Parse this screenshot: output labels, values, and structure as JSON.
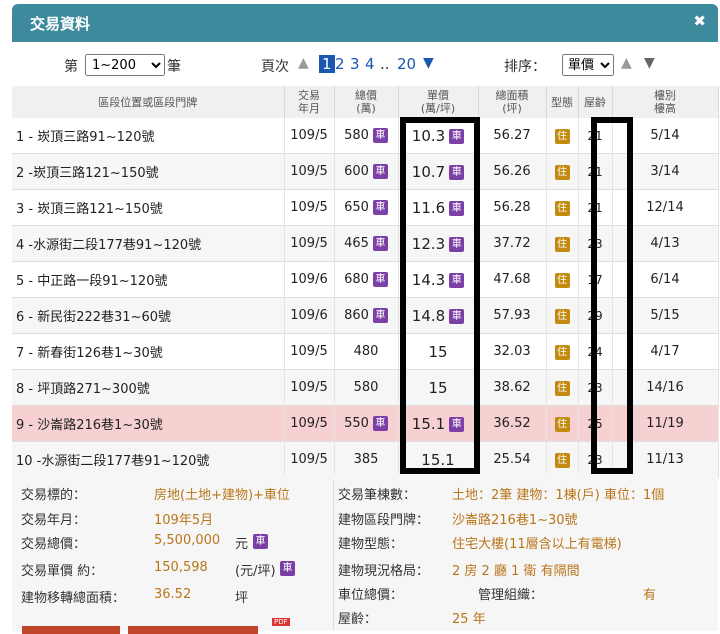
{
  "window": {
    "title": "交易資料",
    "close_glyph": "✖"
  },
  "controls": {
    "per_page_prefix": "第",
    "per_page_value": "1~200",
    "per_page_suffix": "筆",
    "page_label": "頁次",
    "pages": [
      "1",
      "2",
      "3",
      "4",
      "..",
      "20"
    ],
    "sort_label": "排序：",
    "sort_value": "單價"
  },
  "table": {
    "headers": [
      "區段位置或區段門牌",
      "交易\n年月",
      "總價\n(萬)",
      "單價\n(萬/坪)",
      "總面積\n(坪)",
      "型態",
      "屋齡",
      "樓別\n樓高"
    ],
    "car_glyph": "車",
    "residence_glyph": "住",
    "rows": [
      {
        "loc": "1 - 崁頂三路91~120號",
        "date": "109/5",
        "total": "580",
        "total_car": true,
        "unit": "10.3",
        "unit_car": true,
        "area": "56.27",
        "age": "21",
        "floor": "5/14"
      },
      {
        "loc": "2 -崁頂三路121~150號",
        "date": "109/5",
        "total": "600",
        "total_car": true,
        "unit": "10.7",
        "unit_car": true,
        "area": "56.26",
        "age": "21",
        "floor": "3/14"
      },
      {
        "loc": "3 - 崁頂三路121~150號",
        "date": "109/5",
        "total": "650",
        "total_car": true,
        "unit": "11.6",
        "unit_car": true,
        "area": "56.28",
        "age": "21",
        "floor": "12/14"
      },
      {
        "loc": "4 -水源街二段177巷91~120號",
        "date": "109/5",
        "total": "465",
        "total_car": true,
        "unit": "12.3",
        "unit_car": true,
        "area": "37.72",
        "age": "23",
        "floor": "4/13"
      },
      {
        "loc": "5 - 中正路一段91~120號",
        "date": "109/6",
        "total": "680",
        "total_car": true,
        "unit": "14.3",
        "unit_car": true,
        "area": "47.68",
        "age": "17",
        "floor": "6/14"
      },
      {
        "loc": "6 - 新民街222巷31~60號",
        "date": "109/6",
        "total": "860",
        "total_car": true,
        "unit": "14.8",
        "unit_car": true,
        "area": "57.93",
        "age": "29",
        "floor": "5/15"
      },
      {
        "loc": "7 - 新春街126巷1~30號",
        "date": "109/5",
        "total": "480",
        "total_car": false,
        "unit": "15",
        "unit_car": false,
        "area": "32.03",
        "age": "24",
        "floor": "4/17"
      },
      {
        "loc": "8 - 坪頂路271~300號",
        "date": "109/5",
        "total": "580",
        "total_car": false,
        "unit": "15",
        "unit_car": false,
        "area": "38.62",
        "age": "23",
        "floor": "14/16"
      },
      {
        "loc": "9 - 沙崙路216巷1~30號",
        "date": "109/5",
        "total": "550",
        "total_car": true,
        "unit": "15.1",
        "unit_car": true,
        "area": "36.52",
        "age": "25",
        "floor": "11/19"
      },
      {
        "loc": "10 -水源街二段177巷91~120號",
        "date": "109/5",
        "total": "385",
        "total_car": false,
        "unit": "15.1",
        "unit_car": false,
        "area": "25.54",
        "age": "23",
        "floor": "11/13"
      }
    ]
  },
  "detail": {
    "left": [
      {
        "label": "交易標的：",
        "value": "房地(土地+建物)+車位"
      },
      {
        "label": "交易年月：",
        "value": "109年5月"
      },
      {
        "label": "交易總價：",
        "value": "5,500,000",
        "unit": "元"
      },
      {
        "label": "交易單價 約：",
        "value": "150,598",
        "unit": "(元/坪)"
      },
      {
        "label": "建物移轉總面積：",
        "value": "36.52",
        "unit": "坪"
      }
    ],
    "right": [
      {
        "label": "交易筆棟數：",
        "value": "土地：2筆 建物：1棟(戶) 車位：1個"
      },
      {
        "label": "建物區段門牌：",
        "value": "沙崙路216巷1~30號"
      },
      {
        "label": "建物型態：",
        "value": "住宅大樓(11層含以上有電梯)"
      },
      {
        "label": "建物現況格局：",
        "value": "2 房 2 廳 1 衛 有隔間"
      },
      {
        "label": "車位總價：",
        "value": "管理組織：",
        "extra": "有"
      },
      {
        "label": "屋齡：",
        "value": "25 年"
      }
    ],
    "pdf_label": "PDF"
  },
  "colors": {
    "title_bar": "#3d8a9d",
    "car_badge": "#7b3fa6",
    "residence_badge": "#c38a12",
    "highlight_row": "#f7d0d2",
    "value_text": "#b8761a"
  }
}
